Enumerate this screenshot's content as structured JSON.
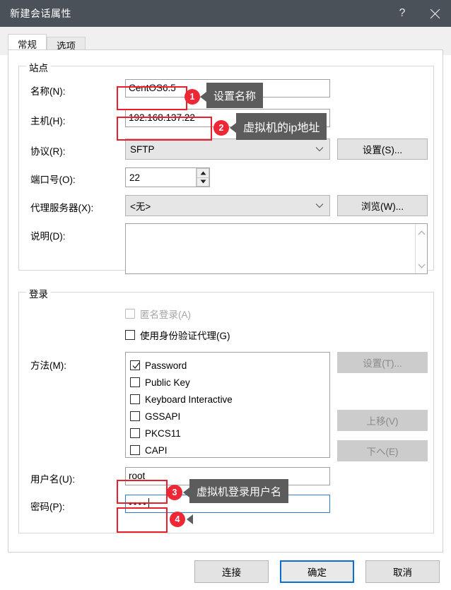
{
  "window": {
    "title": "新建会话属性",
    "help_icon": "question-mark-icon",
    "close_icon": "close-icon"
  },
  "tabs": [
    {
      "label": "常规",
      "active": true
    },
    {
      "label": "选项",
      "active": false
    }
  ],
  "site_group": {
    "title": "站点",
    "fields": {
      "name_label": "名称(N):",
      "name_value": "CentOS6.5",
      "host_label": "主机(H):",
      "host_value": "192.168.137.22",
      "protocol_label": "协议(R):",
      "protocol_value": "SFTP",
      "protocol_button": "设置(S)...",
      "port_label": "端口号(O):",
      "port_value": "22",
      "proxy_label": "代理服务器(X):",
      "proxy_value": "<无>",
      "proxy_button": "浏览(W)...",
      "desc_label": "说明(D):",
      "desc_value": ""
    }
  },
  "login_group": {
    "title": "登录",
    "anonymous_label": "匿名登录(A)",
    "anonymous_checked": false,
    "anonymous_disabled": true,
    "auth_agent_label": "使用身份验证代理(G)",
    "auth_agent_checked": false,
    "method_label": "方法(M):",
    "methods": [
      {
        "label": "Password",
        "checked": true
      },
      {
        "label": "Public Key",
        "checked": false
      },
      {
        "label": "Keyboard Interactive",
        "checked": false
      },
      {
        "label": "GSSAPI",
        "checked": false
      },
      {
        "label": "PKCS11",
        "checked": false
      },
      {
        "label": "CAPI",
        "checked": false
      }
    ],
    "method_buttons": [
      {
        "label": "设置(T)...",
        "disabled": true
      },
      {
        "label": "上移(V)",
        "disabled": true
      },
      {
        "label": "下へ(E)",
        "disabled": true
      }
    ],
    "username_label": "用户名(U):",
    "username_value": "root",
    "password_label": "密码(P):",
    "password_value": "••••"
  },
  "footer": {
    "connect": "连接",
    "ok": "确定",
    "cancel": "取消"
  },
  "annotations": [
    {
      "badge": "1",
      "text": "设置名称"
    },
    {
      "badge": "2",
      "text": "虚拟机的ip地址"
    },
    {
      "badge": "3",
      "text": "虚拟机登录用户名"
    },
    {
      "badge": "4",
      "text": ""
    }
  ],
  "colors": {
    "titlebar": "#4a5158",
    "annotation_red": "#ee2737",
    "tooltip_bg": "#5c5c5c",
    "focus_blue": "#0b6fce"
  }
}
